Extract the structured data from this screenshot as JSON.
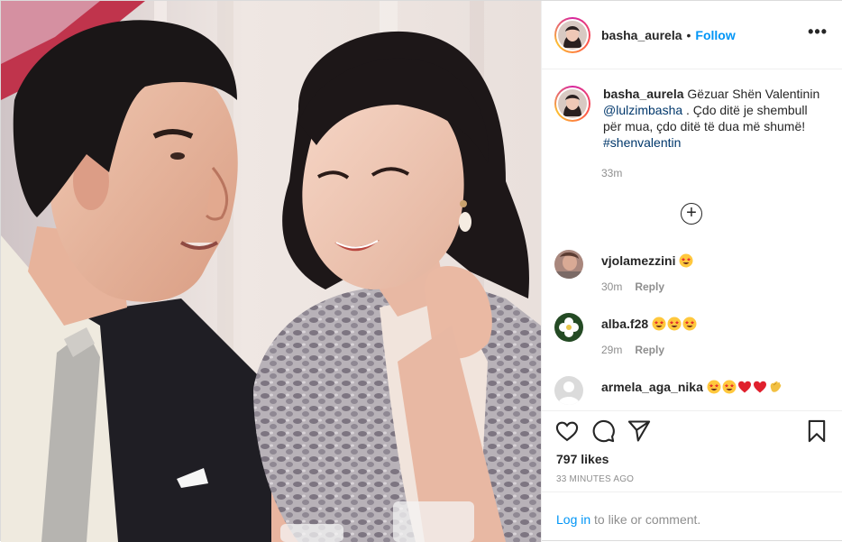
{
  "post": {
    "author": "basha_aurela",
    "separator": "•",
    "follow_label": "Follow",
    "more_icon": "more-horizontal-icon",
    "more_label": "•••"
  },
  "caption": {
    "user": "basha_aurela",
    "text_1": " Gëzuar Shën Valentinin ",
    "mention": "@lulzimbasha",
    "text_2": " . Çdo ditë je shembull për mua, çdo ditë të dua më shumë! ",
    "hashtag": "#shenvalentin",
    "time": "33m"
  },
  "load_more": {
    "icon": "plus-circle-icon",
    "label": "+"
  },
  "comments": [
    {
      "user": "vjolamezzini",
      "emojis": [
        "star-struck"
      ],
      "time": "30m",
      "reply_label": "Reply"
    },
    {
      "user": "alba.f28",
      "emojis": [
        "star-struck",
        "star-struck",
        "star-struck"
      ],
      "time": "29m",
      "reply_label": "Reply"
    },
    {
      "user": "armela_aga_nika",
      "emojis": [
        "star-struck",
        "star-struck",
        "red-heart",
        "red-heart",
        "clapping-hands"
      ],
      "time": "",
      "reply_label": ""
    }
  ],
  "actions": {
    "icons": [
      "heart-icon",
      "comment-icon",
      "share-icon",
      "bookmark-icon"
    ],
    "likes": "797 likes",
    "ago": "33 MINUTES AGO"
  },
  "login": {
    "link": "Log in",
    "rest": " to like or comment."
  },
  "colors": {
    "link_blue": "#0095f6",
    "mention_blue": "#00376b",
    "muted_gray": "#8e8e8e",
    "border": "#efefef"
  }
}
